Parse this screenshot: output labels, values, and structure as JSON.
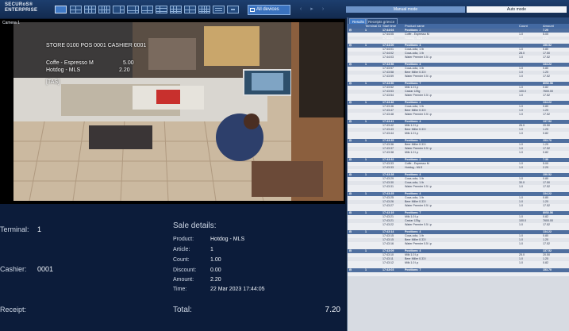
{
  "app": {
    "logo_line1": "SECURoS®",
    "logo_line2": "ENTERPRISE"
  },
  "toolbar": {
    "all_devices_label": "All devices",
    "modes": {
      "manual": "Manual mode",
      "auto": "Auto mode"
    }
  },
  "camera": {
    "label": "Camera 1",
    "overlay": {
      "line1": "STORE 0100 POS 0001 CASHIER 0001",
      "item1_name": "Coffe - Espresso M",
      "item1_price": "5.00",
      "item2_name": "Hotdog - MLS",
      "item2_price": "2.20",
      "tag": "[TAS]"
    }
  },
  "details": {
    "terminal_label": "Terminal:",
    "terminal_value": "1",
    "cashier_label": "Cashier:",
    "cashier_value": "0001",
    "receipt_label": "Receipt:",
    "sale_title": "Sale details:",
    "product_label": "Product:",
    "product_value": "Hotdog - MLS",
    "article_label": "Article:",
    "article_value": "1",
    "count_label": "Count:",
    "count_value": "1.00",
    "discount_label": "Discount:",
    "discount_value": "0.00",
    "amount_label": "Amount:",
    "amount_value": "2.20",
    "time_label": "Time:",
    "time_value": "22 Mar 2023 17:44:05",
    "total_label": "Total:",
    "total_value": "7.20"
  },
  "receipts": {
    "tabs": [
      "Results",
      "Receipts grievce"
    ],
    "columns": [
      "Terminal ID",
      "Start time",
      "Product name",
      "Count",
      "Amount"
    ],
    "groups": [
      {
        "terminal": "1",
        "time": "17:44:04",
        "positions": "Positions: 2",
        "amount": "7.20",
        "items": [
          [
            "17:44:05",
            "Coffe - Espresso M",
            "1.0",
            "5.00"
          ],
          [
            "17:44:05",
            "Hotdog - MLS",
            "1.0",
            "2.20"
          ]
        ]
      },
      {
        "terminal": "1",
        "time": "17:44:00",
        "positions": "Positions: 4",
        "amount": "150.52",
        "items": [
          [
            "17:44:01",
            "Coca-cola, 1 lb",
            "1.0",
            "0.80"
          ],
          [
            "17:44:02",
            "Coca-cola, 1 lb",
            "28.0",
            "17.50"
          ],
          [
            "17:44:03",
            "Water Premier 0.5 l.p",
            "1.0",
            "17.52"
          ]
        ]
      },
      {
        "terminal": "1",
        "time": "17:43:56",
        "positions": "Positions: 4",
        "amount": "134.22",
        "items": [
          [
            "17:43:57",
            "Coca-cola, 1 lb",
            "1.0",
            "0.80"
          ],
          [
            "17:43:58",
            "Beer Miller 0.33 l",
            "1.0",
            "1.20"
          ],
          [
            "17:43:59",
            "Water Premier 0.5 l.p",
            "1.0",
            "17.52"
          ]
        ]
      },
      {
        "terminal": "1",
        "time": "17:43:50",
        "positions": "Positions: 7",
        "amount": "8052.56",
        "items": [
          [
            "17:43:52",
            "Milk 1.0 l.p",
            "1.0",
            "0.82"
          ],
          [
            "17:43:53",
            "Caviar 125g",
            "100.0",
            "7600.00"
          ],
          [
            "17:43:54",
            "Water Premier 0.5 l.p",
            "1.0",
            "17.52"
          ]
        ]
      },
      {
        "terminal": "1",
        "time": "17:43:46",
        "positions": "Positions: 4",
        "amount": "134.22",
        "items": [
          [
            "17:43:46",
            "Coca-cola, 1 lb",
            "1.0",
            "0.80"
          ],
          [
            "17:43:47",
            "Beer Miller 0.33 l",
            "1.0",
            "1.20"
          ],
          [
            "17:43:48",
            "Water Premier 0.5 l.p",
            "1.0",
            "17.52"
          ]
        ]
      },
      {
        "terminal": "1",
        "time": "17:43:41",
        "positions": "Positions: 4",
        "amount": "137.52",
        "items": [
          [
            "17:43:42",
            "Milk 1.0 l.p",
            "26.0",
            "20.50"
          ],
          [
            "17:43:43",
            "Beer Miller 0.33 l",
            "1.0",
            "1.20"
          ],
          [
            "17:43:44",
            "Milk 1.0 l.p",
            "1.0",
            "0.82"
          ]
        ]
      },
      {
        "terminal": "1",
        "time": "17:43:35",
        "positions": "Positions: 7",
        "amount": "153.70",
        "items": [
          [
            "17:43:36",
            "Beer Miller 0.33 l",
            "1.0",
            "1.20"
          ],
          [
            "17:43:37",
            "Water Premier 0.5 l.p",
            "1.0",
            "17.52"
          ],
          [
            "17:43:38",
            "Milk 1.0 l.p",
            "1.0",
            "0.82"
          ]
        ]
      },
      {
        "terminal": "1",
        "time": "17:43:32",
        "positions": "Positions: 2",
        "amount": "7.30",
        "items": [
          [
            "17:43:33",
            "Coffe - Espresso M",
            "1.0",
            "5.00"
          ],
          [
            "17:43:33",
            "Hotdog - MLS",
            "1.0",
            "2.20"
          ]
        ]
      },
      {
        "terminal": "1",
        "time": "17:43:28",
        "positions": "Positions: 4",
        "amount": "150.52",
        "items": [
          [
            "17:43:29",
            "Coca-cola, 1 lb",
            "1.0",
            "0.80"
          ],
          [
            "17:43:30",
            "Coca-cola, 1 lb",
            "30.0",
            "17.50"
          ],
          [
            "17:43:31",
            "Water Premier 0.5 l.p",
            "1.0",
            "17.52"
          ]
        ]
      },
      {
        "terminal": "1",
        "time": "17:43:25",
        "positions": "Positions: 4",
        "amount": "134.22",
        "items": [
          [
            "17:43:25",
            "Coca-cola, 1 lb",
            "1.0",
            "0.80"
          ],
          [
            "17:43:26",
            "Beer Miller 0.33 l",
            "1.0",
            "1.20"
          ],
          [
            "17:43:27",
            "Water Premier 0.5 l.p",
            "1.0",
            "17.52"
          ]
        ]
      },
      {
        "terminal": "1",
        "time": "17:43:19",
        "positions": "Positions: 7",
        "amount": "8052.56",
        "items": [
          [
            "17:43:21",
            "Milk 1.0 l.p",
            "1.0",
            "0.82"
          ],
          [
            "17:43:21",
            "Caviar 125g",
            "100.0",
            "7600.00"
          ],
          [
            "17:43:22",
            "Water Premier 0.5 l.p",
            "1.0",
            "17.52"
          ]
        ]
      },
      {
        "terminal": "1",
        "time": "17:43:14",
        "positions": "Positions: 4",
        "amount": "134.22",
        "items": [
          [
            "17:43:15",
            "Coca-cola, 1 lb",
            "1.0",
            "0.80"
          ],
          [
            "17:43:15",
            "Beer Miller 0.33 l",
            "1.0",
            "1.20"
          ],
          [
            "17:43:16",
            "Water Premier 0.5 l.p",
            "1.0",
            "17.52"
          ]
        ]
      },
      {
        "terminal": "1",
        "time": "17:43:09",
        "positions": "Positions: 4",
        "amount": "137.52",
        "items": [
          [
            "17:43:10",
            "Milk 1.0 l.p",
            "25.0",
            "20.50"
          ],
          [
            "17:43:11",
            "Beer Miller 0.33 l",
            "1.0",
            "1.20"
          ],
          [
            "17:43:12",
            "Milk 1.0 l.p",
            "1.0",
            "0.82"
          ]
        ]
      },
      {
        "terminal": "1",
        "time": "17:43:03",
        "positions": "Positions: 7",
        "amount": "153.70",
        "items": []
      }
    ]
  }
}
